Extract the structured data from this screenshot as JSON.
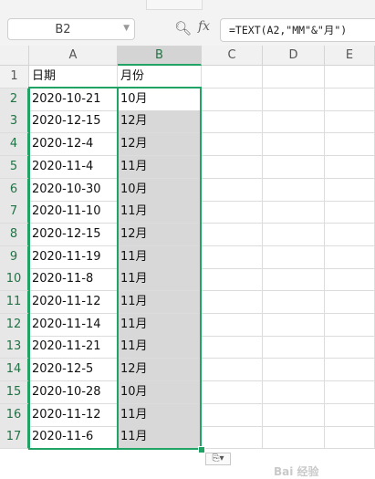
{
  "formula_bar": {
    "name_box": "B2",
    "fx_label": "fx",
    "formula": "=TEXT(A2,\"MM\"&\"月\")"
  },
  "columns": [
    "A",
    "B",
    "C",
    "D",
    "E"
  ],
  "row_numbers": [
    "1",
    "2",
    "3",
    "4",
    "5",
    "6",
    "7",
    "8",
    "9",
    "10",
    "11",
    "12",
    "13",
    "14",
    "15",
    "16",
    "17"
  ],
  "cells": [
    {
      "a": "日期",
      "b": "月份"
    },
    {
      "a": "2020-10-21",
      "b": "10月"
    },
    {
      "a": "2020-12-15",
      "b": "12月"
    },
    {
      "a": "2020-12-4",
      "b": "12月"
    },
    {
      "a": "2020-11-4",
      "b": "11月"
    },
    {
      "a": "2020-10-30",
      "b": "10月"
    },
    {
      "a": "2020-11-10",
      "b": "11月"
    },
    {
      "a": "2020-12-15",
      "b": "12月"
    },
    {
      "a": "2020-11-19",
      "b": "11月"
    },
    {
      "a": "2020-11-8",
      "b": "11月"
    },
    {
      "a": "2020-11-12",
      "b": "11月"
    },
    {
      "a": "2020-11-14",
      "b": "11月"
    },
    {
      "a": "2020-11-21",
      "b": "11月"
    },
    {
      "a": "2020-12-5",
      "b": "12月"
    },
    {
      "a": "2020-10-28",
      "b": "10月"
    },
    {
      "a": "2020-11-12",
      "b": "11月"
    },
    {
      "a": "2020-11-6",
      "b": "11月"
    }
  ],
  "watermark": "Bai 经验",
  "colors": {
    "selection": "#21a366",
    "header_bg": "#f1f1f1",
    "selected_fill": "#d8d8d8"
  }
}
